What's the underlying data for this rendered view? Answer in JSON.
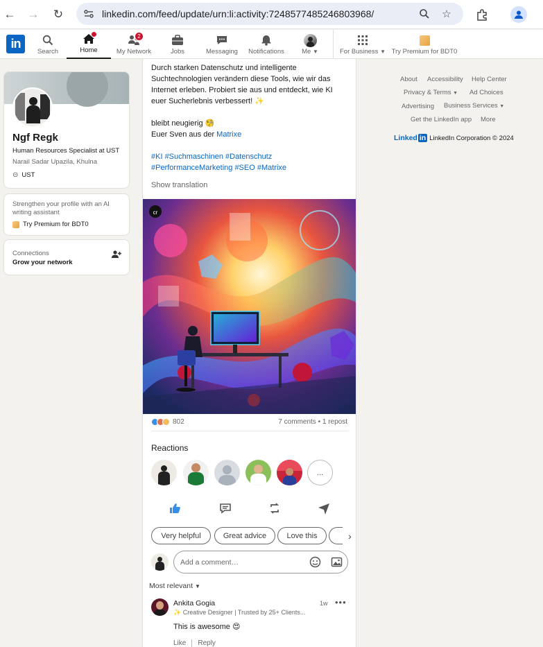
{
  "browser": {
    "url": "linkedin.com/feed/update/urn:li:activity:7248577485246803968/"
  },
  "nav": {
    "logo": "in",
    "items": [
      {
        "label": "Search",
        "icon": "search-icon"
      },
      {
        "label": "Home",
        "icon": "home-icon",
        "active": true
      },
      {
        "label": "My Network",
        "icon": "network-icon",
        "badge": "2"
      },
      {
        "label": "Jobs",
        "icon": "briefcase-icon"
      },
      {
        "label": "Messaging",
        "icon": "messaging-icon"
      },
      {
        "label": "Notifications",
        "icon": "bell-icon"
      },
      {
        "label": "Me",
        "icon": "avatar"
      }
    ],
    "for_business": "For Business",
    "premium": "Try Premium for BDT0"
  },
  "profile": {
    "name": "Ngf Regk",
    "headline": "Human Resources Specialist at UST",
    "location": "Narail Sadar Upazila, Khulna",
    "company": "UST"
  },
  "premium_card": {
    "text": "Strengthen your profile with an AI writing assistant",
    "cta": "Try Premium for BDT0"
  },
  "connections_card": {
    "title": "Connections",
    "subtitle": "Grow your network"
  },
  "post": {
    "lines": [
      "Durch starken Datenschutz und intelligente",
      "Suchtechnologien verändern diese Tools, wie wir das",
      "Internet erleben. Probiert sie aus und entdeckt, wie KI",
      "euer Sucherlebnis verbessert! ✨"
    ],
    "closing": "bleibt neugierig 🧐",
    "signature_prefix": "Euer Sven aus der ",
    "signature_link": "Matrixe",
    "hashtags_1": "#KI #Suchmaschinen #Datenschutz",
    "hashtags_2": "#PerformanceMarketing #SEO #Matrixe",
    "show_translation": "Show translation",
    "image_badge": "cr",
    "reaction_count": "802",
    "comments_reposts": "7 comments • 1 repost",
    "reactions_title": "Reactions",
    "more_label": "..."
  },
  "suggestions": [
    "Very helpful",
    "Great advice",
    "Love this"
  ],
  "comment_box": {
    "placeholder": "Add a comment…"
  },
  "sort": "Most relevant",
  "comment": {
    "author": "Ankita Gogia",
    "headline": "✨ Creative Designer | Trusted by 25+ Clients...",
    "time": "1w",
    "text": "This is awesome 😍",
    "like": "Like",
    "reply": "Reply"
  },
  "footer": {
    "links": [
      "About",
      "Accessibility",
      "Help Center",
      "Privacy & Terms",
      "Ad Choices",
      "Advertising",
      "Business Services",
      "Get the LinkedIn app",
      "More"
    ],
    "brand": "Linked",
    "brand_in": "in",
    "copyright": "LinkedIn Corporation © 2024"
  },
  "colors": {
    "brand": "#0a66c2",
    "badge": "#cb112d",
    "background": "#f4f2ee"
  }
}
